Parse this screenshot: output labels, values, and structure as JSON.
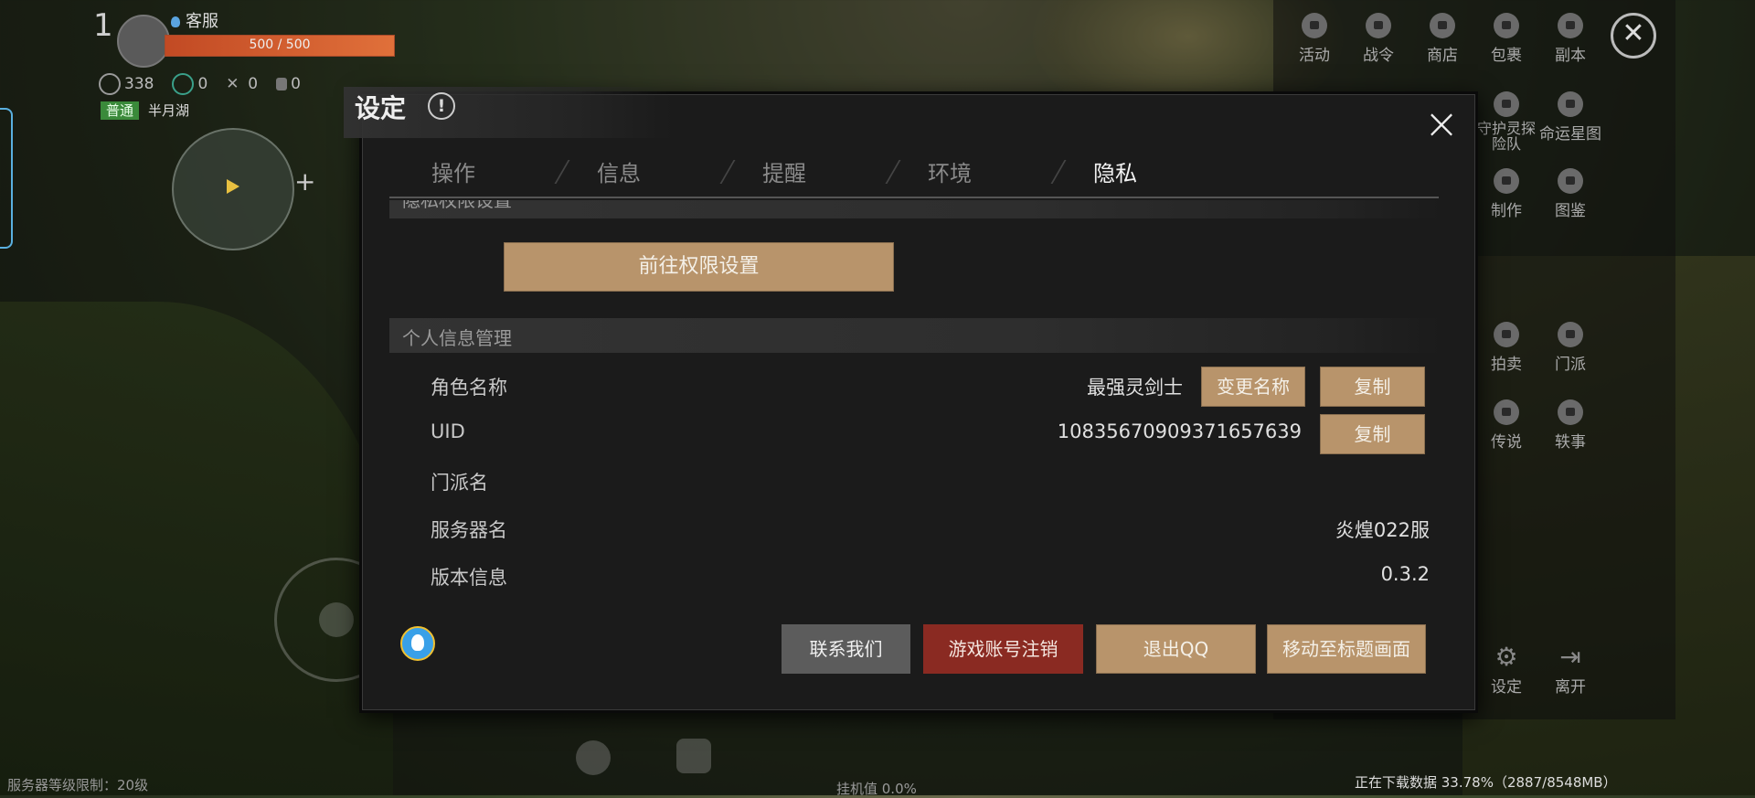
{
  "hud": {
    "level": "1",
    "service": "客服",
    "hp_text": "500 / 500",
    "hp_fraction": 1.0,
    "stat1": "338",
    "stat2": "0",
    "stat3": "0",
    "stat4": "0",
    "mode_tag": "普通",
    "location": "半月湖",
    "bottom_left": "服务器等级限制：20级",
    "bottom_mid": "挂机值 0.0%",
    "download_status": "正在下载数据 33.78%（2887/8548MB）"
  },
  "right_menu": {
    "items": [
      {
        "label": "活动",
        "icon": "lock-icon"
      },
      {
        "label": "战令",
        "icon": "lock-icon"
      },
      {
        "label": "商店",
        "icon": "lock-icon"
      },
      {
        "label": "包裹",
        "icon": "lock-icon"
      },
      {
        "label": "副本",
        "icon": "lock-icon"
      },
      {
        "label": "守护灵探险队",
        "icon": "lock-icon"
      },
      {
        "label": "命运星图",
        "icon": "lock-icon"
      },
      {
        "label": "制作",
        "icon": "lock-icon"
      },
      {
        "label": "图鉴",
        "icon": "lock-icon"
      },
      {
        "label": "拍卖",
        "icon": "lock-icon"
      },
      {
        "label": "门派",
        "icon": "lock-icon"
      },
      {
        "label": "传说",
        "icon": "lock-icon"
      },
      {
        "label": "轶事",
        "icon": "lock-icon"
      },
      {
        "label": "设定",
        "icon": "gear-icon"
      },
      {
        "label": "离开",
        "icon": "exit-icon"
      }
    ]
  },
  "dialog": {
    "title": "设定",
    "help_glyph": "!",
    "close_glyph": "×",
    "tabs": [
      "操作",
      "信息",
      "提醒",
      "环境",
      "隐私"
    ],
    "active_tab": "隐私",
    "privacy_section": "隐私权限设置",
    "goto_permissions_button": "前往权限设置",
    "personal_section": "个人信息管理",
    "rows": {
      "role_name_label": "角色名称",
      "role_name_value": "最强灵剑士",
      "rename_button": "变更名称",
      "copy_name_button": "复制",
      "uid_label": "UID",
      "uid_value": "1083567090937165763​9",
      "copy_uid_button": "复制",
      "sect_label": "门派名",
      "sect_value": "",
      "server_label": "服务器名",
      "server_value": "炎煌022服",
      "version_label": "版本信息",
      "version_value": "0.3.2"
    },
    "footer": {
      "contact_button": "联系我们",
      "delete_account_button": "游戏账号注销",
      "logout_qq_button": "退出QQ",
      "title_screen_button": "移动至标题画面"
    }
  }
}
